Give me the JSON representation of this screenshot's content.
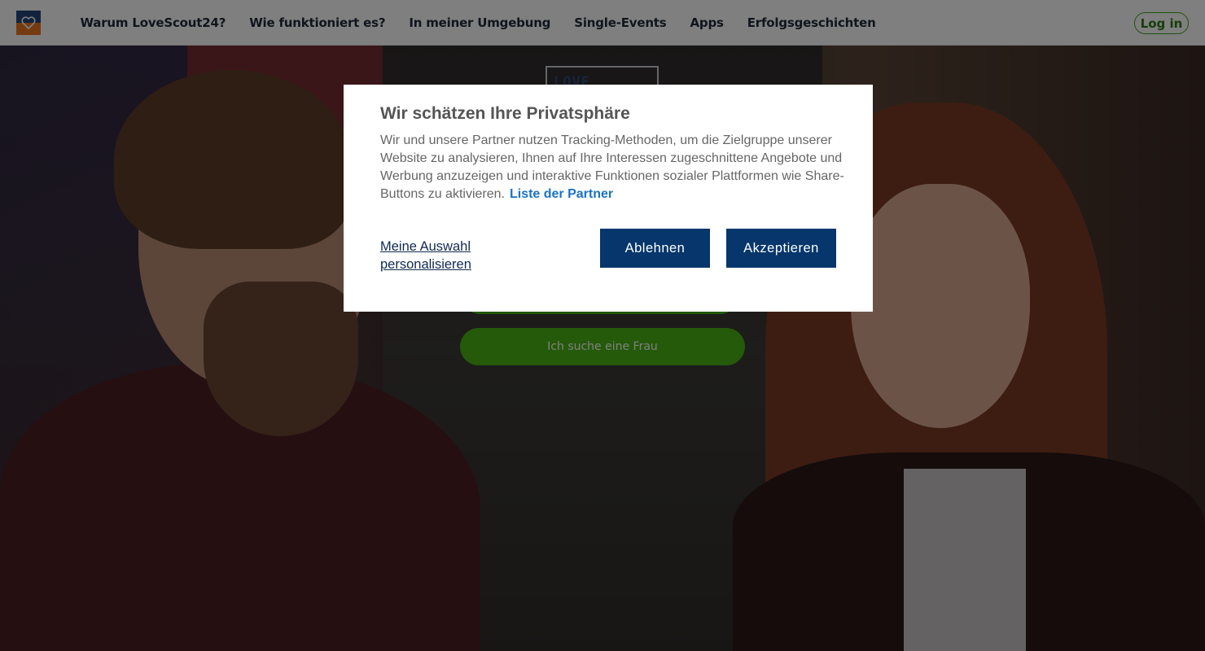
{
  "header": {
    "nav": [
      {
        "label": "Warum LoveScout24?"
      },
      {
        "label": "Wie funktioniert es?"
      },
      {
        "label": "In meiner Umgebung"
      },
      {
        "label": "Single-Events"
      },
      {
        "label": "Apps"
      },
      {
        "label": "Erfolgsgeschichten"
      }
    ],
    "login_label": "Log in",
    "logo_icon": "heart-logo-icon"
  },
  "hero": {
    "logo_text": "LOVE",
    "search_woman_label": "Ich suche eine Frau"
  },
  "consent_dialog": {
    "title": "Wir schätzen Ihre Privatsphäre",
    "body": "Wir und unsere Partner nutzen Tracking-Methoden, um die Zielgruppe unserer Website zu analysieren, Ihnen auf Ihre Interessen zugeschnittene Angebote und Werbung anzuzeigen und interaktive Funktionen sozialer Plattformen wie Share-Buttons zu aktivieren.",
    "partner_link": "Liste der Partner",
    "personalize_label": "Meine Auswahl personalisieren",
    "reject_label": "Ablehnen",
    "accept_label": "Akzeptieren"
  },
  "colors": {
    "brand_green": "#49b512",
    "dialog_button": "#06366b",
    "link_blue": "#1a73c4",
    "logo_blue": "#27467a",
    "logo_orange": "#e87722"
  }
}
